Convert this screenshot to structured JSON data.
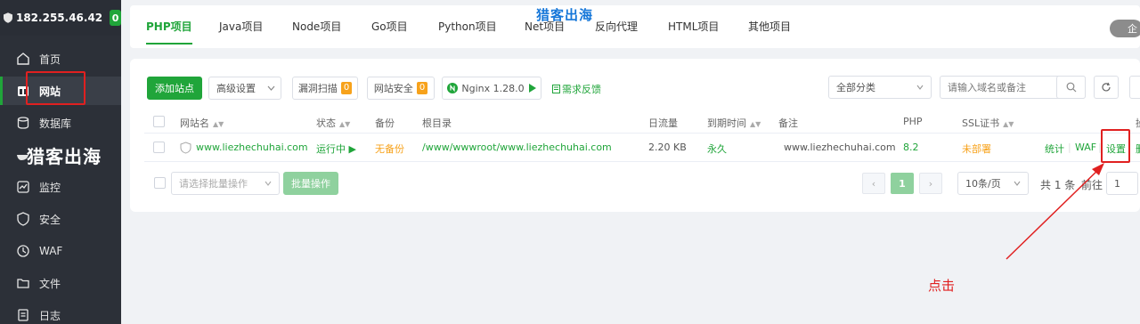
{
  "sidebar": {
    "ip": "182.255.46.42",
    "count": "0",
    "items": [
      {
        "label": "首页",
        "icon": "home-icon"
      },
      {
        "label": "网站",
        "icon": "website-icon"
      },
      {
        "label": "数据库",
        "icon": "database-icon"
      },
      {
        "label": "",
        "icon": "docker-icon"
      },
      {
        "label": "监控",
        "icon": "monitor-icon"
      },
      {
        "label": "安全",
        "icon": "shield-icon"
      },
      {
        "label": "WAF",
        "icon": "waf-icon"
      },
      {
        "label": "文件",
        "icon": "folder-icon"
      },
      {
        "label": "日志",
        "icon": "log-icon"
      }
    ]
  },
  "watermark": "猎客出海",
  "tabs": [
    "PHP项目",
    "Java项目",
    "Node项目",
    "Go项目",
    "Python项目",
    "Net项目",
    "反向代理",
    "HTML项目",
    "其他项目"
  ],
  "enterprise_badge": "企",
  "toolbar": {
    "add_site": "添加站点",
    "advanced": "高级设置",
    "vuln_scan": "漏洞扫描",
    "vuln_count": "0",
    "site_security": "网站安全",
    "security_count": "0",
    "nginx": "Nginx 1.28.0",
    "feedback": "需求反馈",
    "category": "全部分类",
    "search_placeholder": "请输入域名或备注"
  },
  "table": {
    "headers": [
      "网站名",
      "状态",
      "备份",
      "根目录",
      "日流量",
      "到期时间",
      "备注",
      "PHP",
      "SSL证书",
      "操"
    ],
    "rows": [
      {
        "name": "www.liezhechuhai.com",
        "status": "运行中",
        "backup": "无备份",
        "root": "/www/wwwroot/www.liezhechuhai.com",
        "traffic": "2.20 KB",
        "expire": "永久",
        "note": "www.liezhechuhai.com",
        "php": "8.2",
        "ssl": "未部署",
        "actions": [
          "统计",
          "WAF",
          "设置",
          "删"
        ]
      }
    ]
  },
  "footer": {
    "batch_placeholder": "请选择批量操作",
    "batch_button": "批量操作",
    "page": "1",
    "page_size": "10条/页",
    "total": "共 1 条",
    "goto": "前往",
    "goto_value": "1"
  },
  "annotation": "点击",
  "colors": {
    "accent": "#20a53a",
    "warning": "#f7a21b",
    "annotation": "#e02020",
    "sidebar": "#2c3038"
  }
}
